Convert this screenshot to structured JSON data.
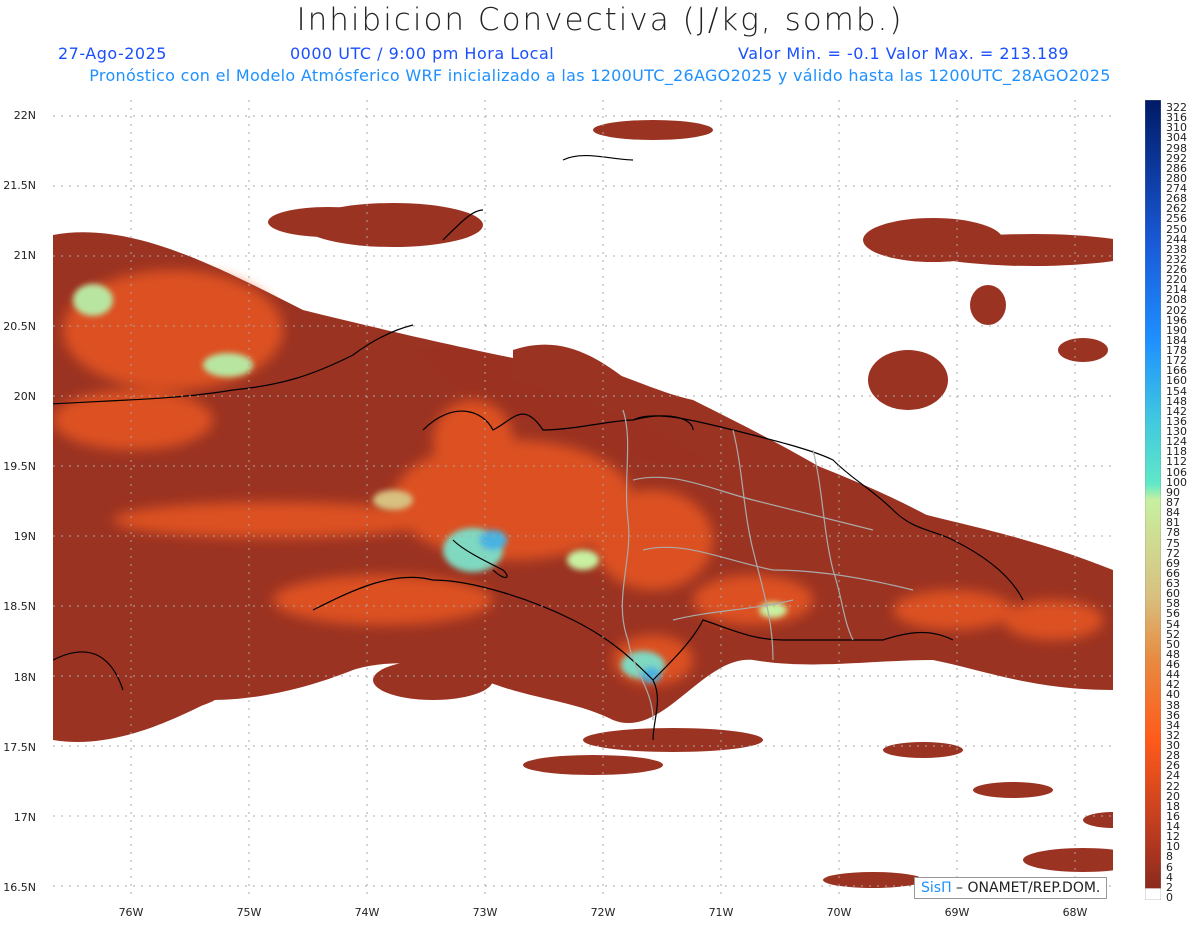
{
  "header": {
    "title": "Inhibicion Convectiva (J/kg, somb.)",
    "date": "27-Ago-2025",
    "time": "0000 UTC / 9:00 pm Hora Local",
    "minmax": "Valor Min. = -0.1  Valor Max. = 213.189",
    "model_line": "Pronóstico con el Modelo Atmósferico WRF inicializado a las 1200UTC_26AGO2025 y válido hasta las  1200UTC_28AGO2025"
  },
  "map": {
    "lat_labels": [
      "22N",
      "21.5N",
      "21N",
      "20.5N",
      "20N",
      "19.5N",
      "19N",
      "18.5N",
      "18N",
      "17.5N",
      "17N",
      "16.5N"
    ],
    "lon_labels": [
      "76W",
      "75W",
      "74W",
      "73W",
      "72W",
      "71W",
      "70W",
      "69W",
      "68W"
    ]
  },
  "colorbar": {
    "ticks": [
      "322",
      "316",
      "310",
      "304",
      "298",
      "292",
      "286",
      "280",
      "274",
      "268",
      "262",
      "256",
      "250",
      "244",
      "238",
      "232",
      "226",
      "220",
      "214",
      "208",
      "202",
      "196",
      "190",
      "184",
      "178",
      "172",
      "166",
      "160",
      "154",
      "148",
      "142",
      "136",
      "130",
      "124",
      "118",
      "112",
      "106",
      "100",
      "90",
      "87",
      "84",
      "81",
      "78",
      "75",
      "72",
      "69",
      "66",
      "63",
      "60",
      "58",
      "56",
      "54",
      "52",
      "50",
      "48",
      "46",
      "44",
      "42",
      "40",
      "38",
      "36",
      "34",
      "32",
      "30",
      "28",
      "26",
      "24",
      "22",
      "20",
      "18",
      "16",
      "14",
      "12",
      "10",
      "8",
      "6",
      "4",
      "2",
      "0"
    ],
    "colors": {
      "high": "#001a66",
      "mid_blue": "#1e90ff",
      "cyan": "#40e0d0",
      "lime": "#c8f0a0",
      "tan": "#d2a060",
      "orange": "#ff5a1a",
      "red_brown": "#8b2a1e",
      "zero": "#ffffff"
    }
  },
  "credit": {
    "brand": "SisΠ",
    "text": " – ONAMET/REP.DOM."
  }
}
